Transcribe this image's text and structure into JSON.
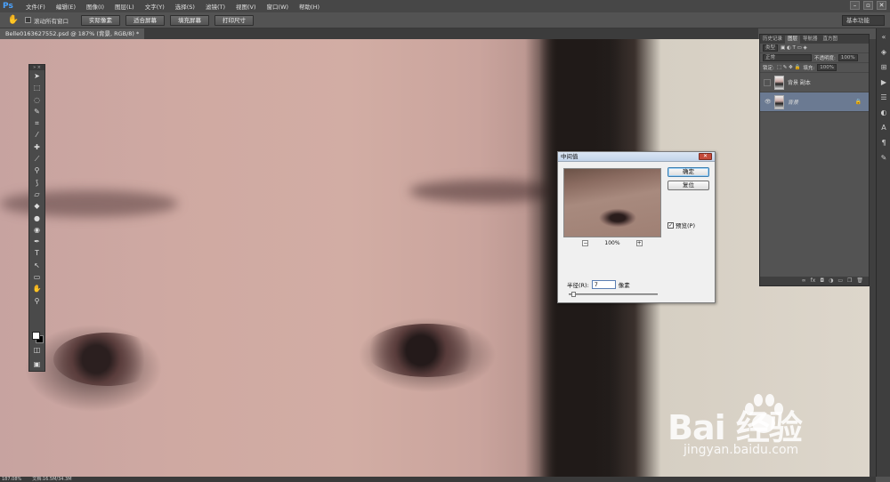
{
  "app": {
    "logo": "Ps"
  },
  "menu": [
    "文件(F)",
    "编辑(E)",
    "图像(I)",
    "图层(L)",
    "文字(Y)",
    "选择(S)",
    "滤镜(T)",
    "视图(V)",
    "窗口(W)",
    "帮助(H)"
  ],
  "window_controls": {
    "min": "–",
    "max": "▫",
    "close": "✕"
  },
  "options": {
    "scroll_all": "滚动所有窗口",
    "buttons": [
      "实际像素",
      "适合屏幕",
      "填充屏幕",
      "打印尺寸"
    ],
    "workspace": "基本功能"
  },
  "document": {
    "tab": "Belle0163627552.psd @ 187% (背景, RGB/8) *"
  },
  "status": {
    "zoom": "187.08%",
    "doc": "文档:16.5M/34.3M"
  },
  "layers_panel": {
    "tabs": [
      "历史记录",
      "图层",
      "导航器",
      "直方图"
    ],
    "kind": "类型",
    "blend": "正常",
    "opacity_label": "不透明度:",
    "opacity": "100%",
    "lock_label": "锁定:",
    "fill_label": "填充:",
    "fill": "100%",
    "layers": [
      {
        "name": "背景 副本",
        "visible": false,
        "selected": false
      },
      {
        "name": "背景",
        "visible": true,
        "selected": true
      }
    ]
  },
  "dialog": {
    "title": "中间值",
    "ok": "确定",
    "reset": "复位",
    "preview_label": "预览(P)",
    "preview_checked": true,
    "zoom": "100%",
    "radius_label": "半径(R):",
    "radius_value": "7",
    "radius_unit": "像素",
    "radius_slider_fraction": 0.03
  },
  "watermark": {
    "brand": "Bai  经验",
    "url": "jingyan.baidu.com"
  }
}
